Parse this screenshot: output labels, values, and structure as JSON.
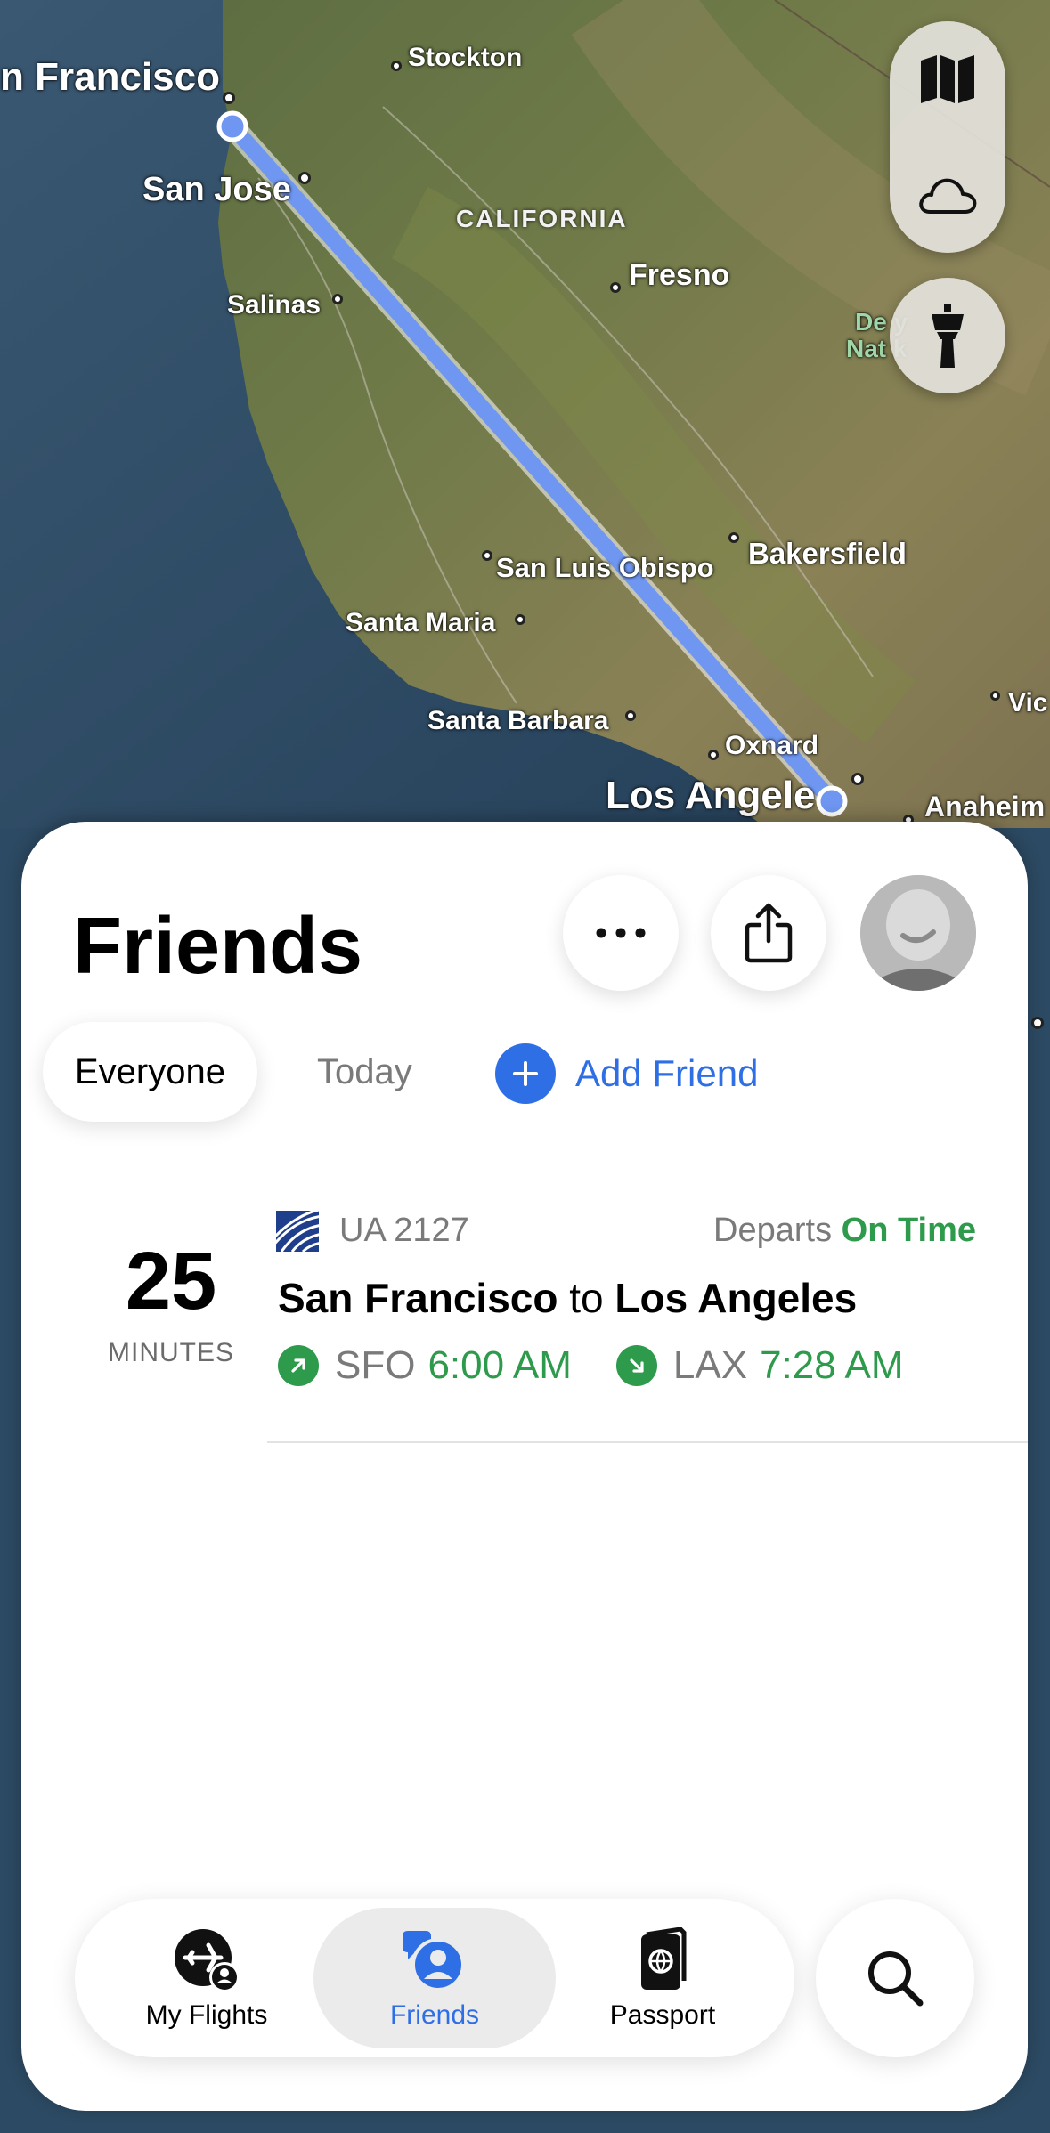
{
  "map": {
    "cities": [
      {
        "key": "sf",
        "label": "n Francisco"
      },
      {
        "key": "stockton",
        "label": "Stockton"
      },
      {
        "key": "sanjose",
        "label": "San Jose"
      },
      {
        "key": "fresno",
        "label": "Fresno"
      },
      {
        "key": "salinas",
        "label": "Salinas"
      },
      {
        "key": "slo",
        "label": "San Luis Obispo"
      },
      {
        "key": "bakersfield",
        "label": "Bakersfield"
      },
      {
        "key": "santamaria",
        "label": "Santa Maria"
      },
      {
        "key": "santabarbara",
        "label": "Santa Barbara"
      },
      {
        "key": "oxnard",
        "label": "Oxnard"
      },
      {
        "key": "la",
        "label": "Los Angele"
      },
      {
        "key": "anaheim",
        "label": "Anaheim"
      },
      {
        "key": "vic",
        "label": "Vic"
      }
    ],
    "region_label": "CALIFORNIA",
    "park_label_line1": "De         y",
    "park_label_line2": "Nat        k",
    "route_color": "#6f97f2",
    "controls": {
      "map_mode_icon": "map-icon",
      "weather_icon": "cloud-icon",
      "airport_icon": "control-tower-icon"
    }
  },
  "sheet": {
    "title": "Friends",
    "more_icon": "ellipsis-icon",
    "share_icon": "share-icon",
    "filters": [
      {
        "label": "Everyone",
        "active": true
      },
      {
        "label": "Today",
        "active": false
      }
    ],
    "add_friend": {
      "label": "Add Friend",
      "icon": "plus-icon"
    },
    "flights": [
      {
        "countdown_value": "25",
        "countdown_unit": "MINUTES",
        "airline_logo": "united-airlines-globe-icon",
        "flight_number": "UA 2127",
        "status_prefix": "Departs",
        "status": "On Time",
        "origin_city": "San Francisco",
        "connector": "to",
        "destination_city": "Los Angeles",
        "origin_code": "SFO",
        "departure_time": "6:00 AM",
        "destination_code": "LAX",
        "arrival_time": "7:28 AM"
      }
    ]
  },
  "tabbar": {
    "tabs": [
      {
        "label": "My Flights",
        "icon": "my-flights-icon",
        "active": false
      },
      {
        "label": "Friends",
        "icon": "friends-icon",
        "active": true
      },
      {
        "label": "Passport",
        "icon": "passport-icon",
        "active": false
      }
    ],
    "search_icon": "search-icon"
  },
  "colors": {
    "accent_blue": "#2f6fe6",
    "on_time_green": "#2e9a4b"
  }
}
